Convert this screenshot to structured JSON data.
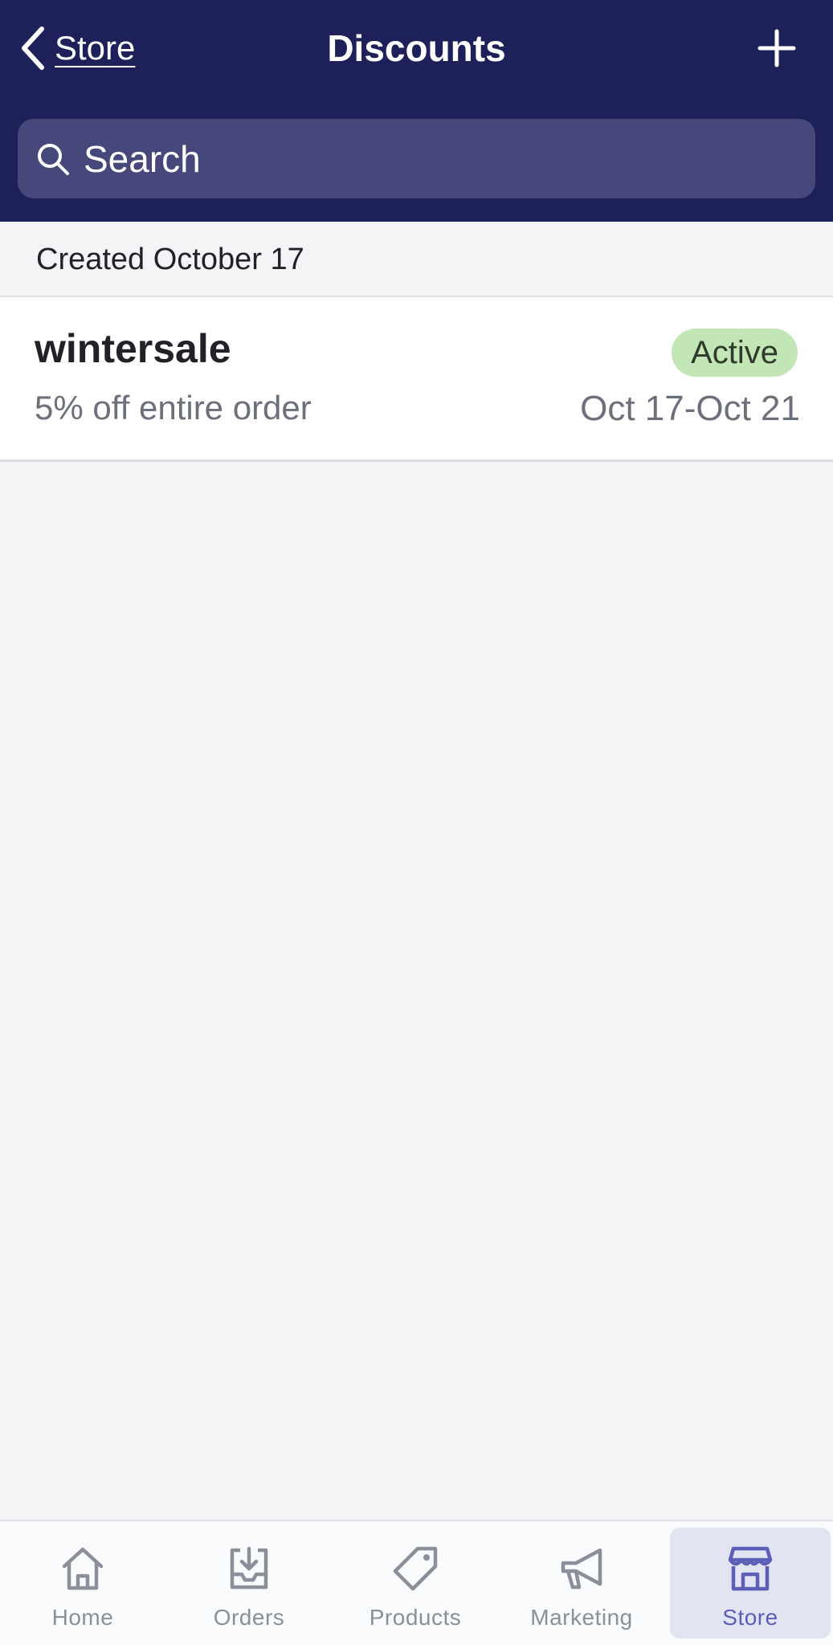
{
  "header": {
    "back_label": "Store",
    "title": "Discounts",
    "add_icon": "plus-icon"
  },
  "search": {
    "placeholder": "Search",
    "value": ""
  },
  "section": {
    "label": "Created October 17"
  },
  "discounts": [
    {
      "name": "wintersale",
      "description": "5% off entire order",
      "status": "Active",
      "dates": "Oct 17-Oct 21"
    }
  ],
  "tabbar": {
    "items": [
      {
        "label": "Home",
        "icon": "home-icon"
      },
      {
        "label": "Orders",
        "icon": "orders-icon"
      },
      {
        "label": "Products",
        "icon": "tag-icon"
      },
      {
        "label": "Marketing",
        "icon": "megaphone-icon"
      },
      {
        "label": "Store",
        "icon": "store-icon"
      }
    ],
    "active": "Store"
  },
  "colors": {
    "header_bg": "#1e2059",
    "search_bg": "#46477b",
    "badge_bg": "#c3e6b6",
    "active_tab": "#5c5fb8"
  }
}
